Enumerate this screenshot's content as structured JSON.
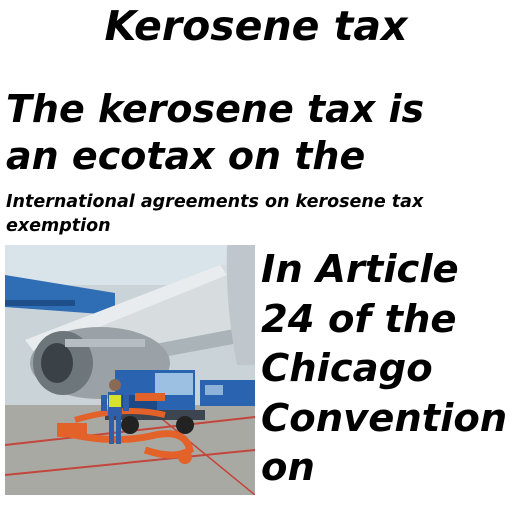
{
  "page": {
    "title": "Kerosene tax",
    "lead_lines": [
      "The kerosene tax is",
      "an ecotax on the"
    ],
    "subheading": "International agreements on kerosene tax exemption",
    "body_lines": [
      "In Article",
      "24 of the",
      "Chicago",
      "Convention",
      "on"
    ]
  },
  "colors": {
    "text": "#000000",
    "background": "#ffffff",
    "tanker_blue": "#2a63b0",
    "hose_orange": "#e2622a"
  }
}
